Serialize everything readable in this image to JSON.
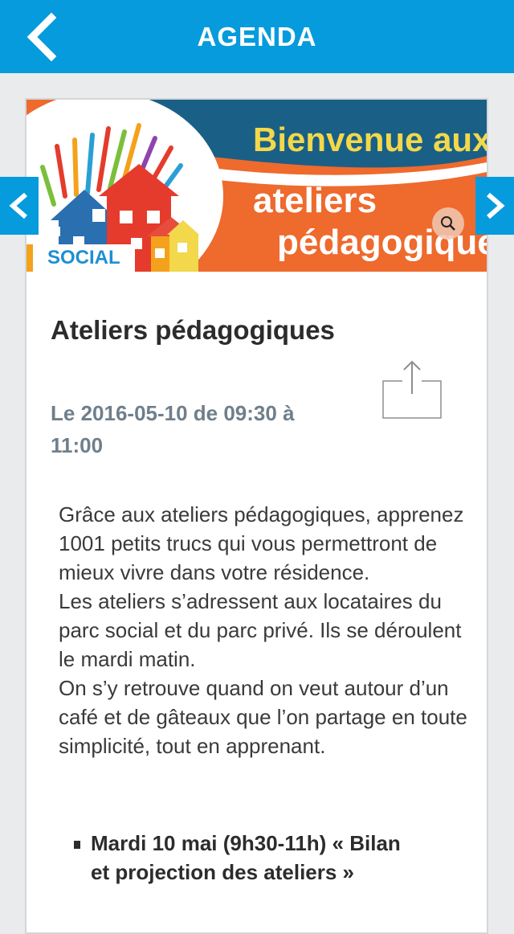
{
  "header": {
    "title": "AGENDA"
  },
  "banner": {
    "line1": "Bienvenue aux",
    "line2": "ateliers",
    "line3": "pédagogiques",
    "category": "SOCIAL"
  },
  "event": {
    "title": "Ateliers pédagogiques",
    "date_line1": "Le 2016-05-10 de 09:30 à",
    "date_line2": "11:00",
    "description": [
      "Grâce aux ateliers pédagogiques, apprenez 1001 petits trucs qui vous permettront de mieux vivre dans votre résidence.",
      "Les ateliers s’adressent aux locataires du parc social et du parc privé. Ils se déroulent le mardi matin.",
      "On s’y retrouve quand on veut autour d’un café et de gâteaux que l’on partage en toute simplicité, tout en apprenant."
    ],
    "sessions": [
      "Mardi 10 mai (9h30-11h) « Bilan et projection des ateliers »"
    ]
  },
  "icons": {
    "back": "chevron-left-icon",
    "prev": "chevron-left-icon",
    "next": "chevron-right-icon",
    "share": "share-icon",
    "zoom": "magnifier-icon"
  },
  "colors": {
    "accent": "#069bdc",
    "banner_orange": "#ee6a2d",
    "banner_blue": "#1a5f86",
    "banner_yellow": "#f2d84a",
    "category_text": "#1e8fd1",
    "date_text": "#6f7f8b"
  }
}
